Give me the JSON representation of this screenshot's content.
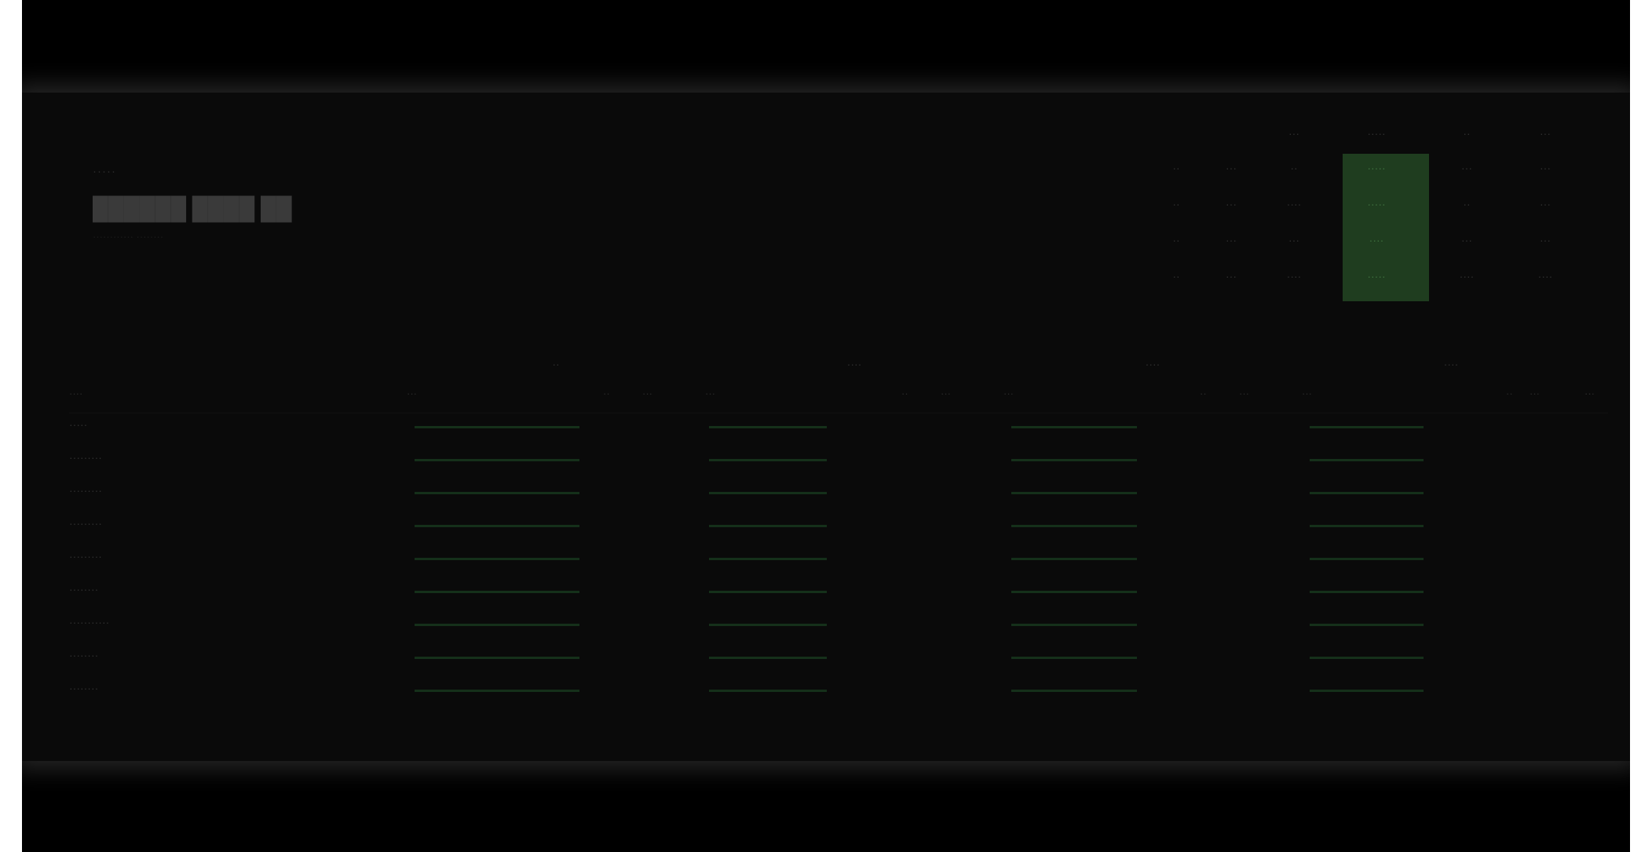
{
  "header": {
    "small_label": "·····",
    "title": "██████ ████ ██",
    "subtitle": "············ ········"
  },
  "mini_table": {
    "headers": [
      "",
      "",
      "···",
      "·····",
      "··",
      "···"
    ],
    "rows": [
      [
        "··",
        "···",
        "··",
        "·····",
        "···",
        "···"
      ],
      [
        "··",
        "···",
        "····",
        "·····",
        "··",
        "···"
      ],
      [
        "··",
        "···",
        "···",
        "····",
        "···",
        "···"
      ],
      [
        "··",
        "···",
        "····",
        "·····",
        "····",
        "····"
      ]
    ]
  },
  "groups": [
    "··",
    "····",
    "····",
    "····"
  ],
  "column_headers": [
    "····",
    "···",
    "··",
    "···",
    "···",
    "··",
    "···",
    "···",
    "··",
    "···",
    "···",
    "··",
    "···",
    "··",
    "···"
  ],
  "rows": [
    {
      "name": "·····"
    },
    {
      "name": "·········"
    },
    {
      "name": "·········"
    },
    {
      "name": "·········"
    },
    {
      "name": "·········"
    },
    {
      "name": "········"
    },
    {
      "name": "···········"
    },
    {
      "name": "········"
    },
    {
      "name": "········"
    }
  ],
  "colors": {
    "background": "#000000",
    "panel": "#0a0a0a",
    "highlight": "#1f3d1f",
    "bar": "#15301a"
  }
}
